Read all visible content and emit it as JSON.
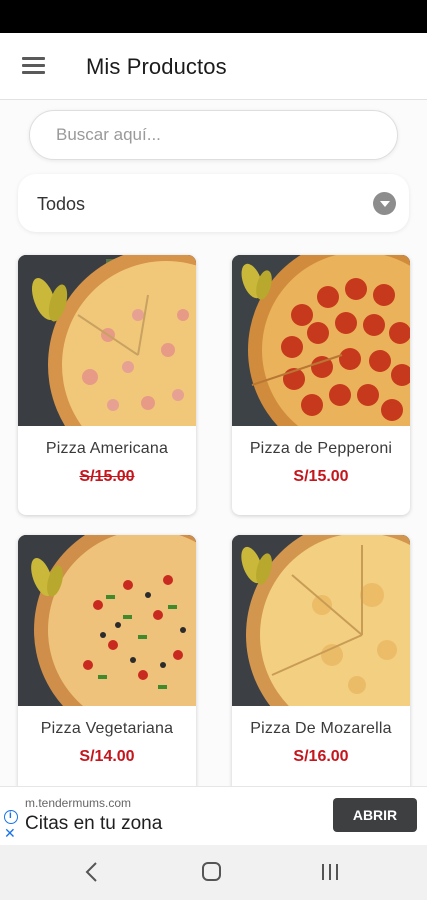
{
  "app_bar": {
    "title": "Mis Productos"
  },
  "search": {
    "placeholder": "Buscar aquí..."
  },
  "category_filter": {
    "selected": "Todos"
  },
  "products": [
    {
      "name": "Pizza Americana",
      "price": "S/15.00",
      "strikethrough": true,
      "image": "pizza-americana-image"
    },
    {
      "name": "Pizza de Pepperoni",
      "price": "S/15.00",
      "strikethrough": false,
      "image": "pizza-pepperoni-image"
    },
    {
      "name": "Pizza Vegetariana",
      "price": "S/14.00",
      "strikethrough": false,
      "image": "pizza-vegetariana-image"
    },
    {
      "name": "Pizza De Mozarella",
      "price": "S/16.00",
      "strikethrough": false,
      "image": "pizza-mozarella-image"
    }
  ],
  "ad": {
    "domain": "m.tendermums.com",
    "headline": "Citas en tu zona",
    "button_label": "ABRIR"
  },
  "colors": {
    "price": "#c4161c",
    "status_bar": "#000000",
    "ad_button": "#3d3f41"
  }
}
